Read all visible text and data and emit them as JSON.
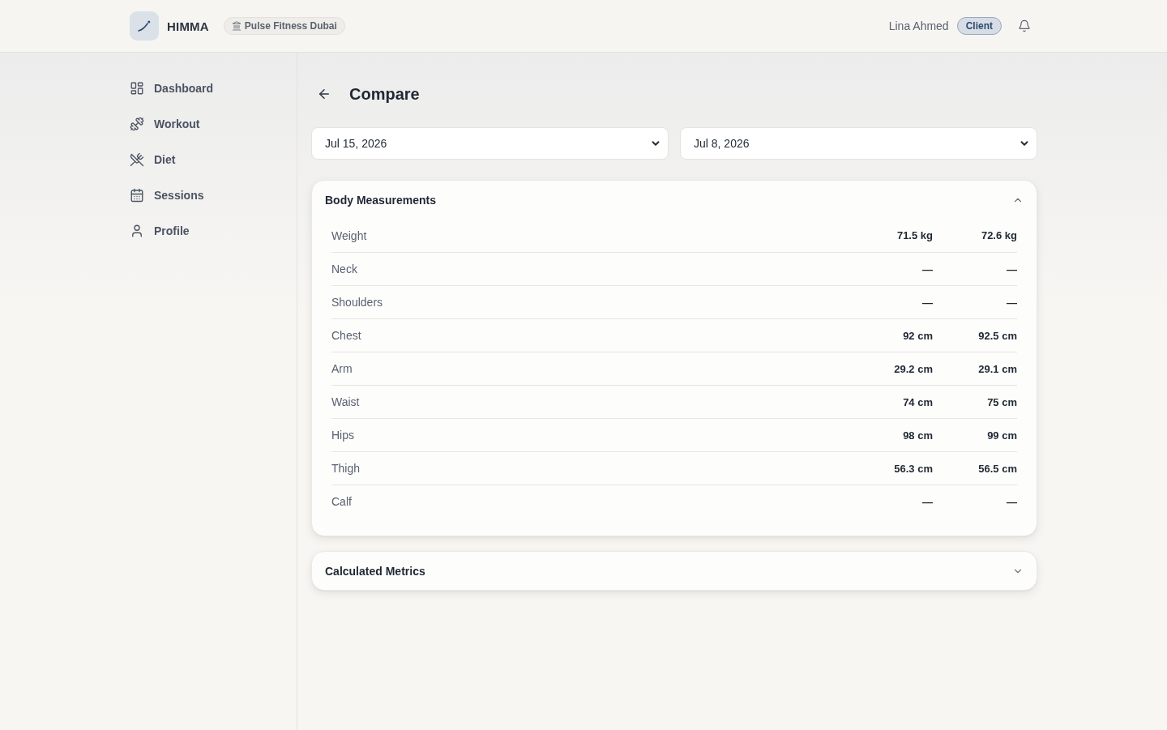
{
  "header": {
    "app_name": "HIMMA",
    "gym": "Pulse Fitness Dubai",
    "user_name": "Lina Ahmed",
    "role": "Client"
  },
  "sidebar": {
    "items": [
      {
        "label": "Dashboard",
        "selected": false
      },
      {
        "label": "Workout",
        "selected": false
      },
      {
        "label": "Diet",
        "selected": false
      },
      {
        "label": "Sessions",
        "selected": false
      },
      {
        "label": "Profile",
        "selected": false
      }
    ]
  },
  "page": {
    "title": "Compare"
  },
  "date_selects": [
    {
      "value": "Jul 15, 2026"
    },
    {
      "value": "Jul 8, 2026"
    }
  ],
  "sections": [
    {
      "title": "Body Measurements",
      "expanded": true,
      "rows": [
        {
          "label": "Weight",
          "values": [
            "71.5 kg",
            "72.6 kg"
          ]
        },
        {
          "label": "Neck",
          "values": [
            "—",
            "—"
          ]
        },
        {
          "label": "Shoulders",
          "values": [
            "—",
            "—"
          ]
        },
        {
          "label": "Chest",
          "values": [
            "92 cm",
            "92.5 cm"
          ]
        },
        {
          "label": "Arm",
          "values": [
            "29.2 cm",
            "29.1 cm"
          ]
        },
        {
          "label": "Waist",
          "values": [
            "74 cm",
            "75 cm"
          ]
        },
        {
          "label": "Hips",
          "values": [
            "98 cm",
            "99 cm"
          ]
        },
        {
          "label": "Thigh",
          "values": [
            "56.3 cm",
            "56.5 cm"
          ]
        },
        {
          "label": "Calf",
          "values": [
            "—",
            "—"
          ]
        }
      ]
    },
    {
      "title": "Calculated Metrics",
      "expanded": false
    }
  ]
}
